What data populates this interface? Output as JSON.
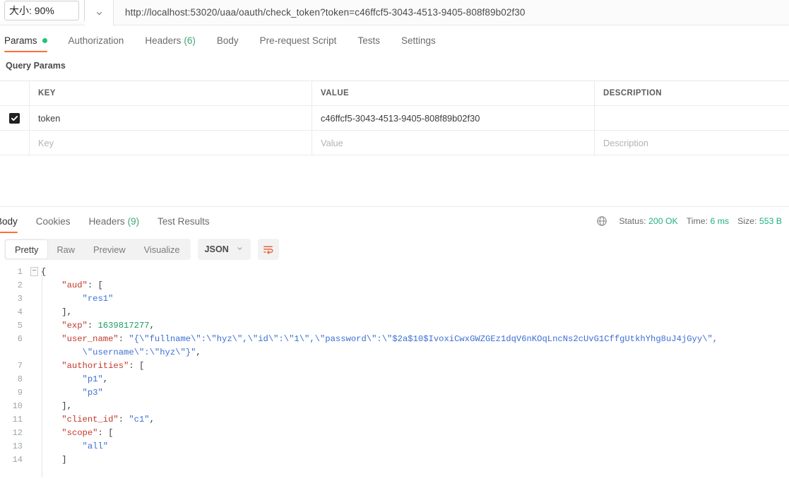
{
  "urlbar": {
    "zoom_label": "大小: 90%",
    "caret_icon": "chevron-down-icon",
    "url": "http://localhost:53020/uaa/oauth/check_token?token=c46ffcf5-3043-4513-9405-808f89b02f30"
  },
  "request_tabs": [
    {
      "label": "Params",
      "active": true,
      "dot": true
    },
    {
      "label": "Authorization",
      "active": false
    },
    {
      "label": "Headers",
      "count": "(6)",
      "active": false
    },
    {
      "label": "Body",
      "active": false
    },
    {
      "label": "Pre-request Script",
      "active": false
    },
    {
      "label": "Tests",
      "active": false
    },
    {
      "label": "Settings",
      "active": false
    }
  ],
  "query_params": {
    "section_label": "Query Params",
    "columns": [
      "KEY",
      "VALUE",
      "DESCRIPTION"
    ],
    "rows": [
      {
        "checked": true,
        "key": "token",
        "value": "c46ffcf5-3043-4513-9405-808f89b02f30",
        "description": ""
      }
    ],
    "placeholder_row": {
      "key": "Key",
      "value": "Value",
      "description": "Description"
    }
  },
  "response_tabs": [
    {
      "label": "Body",
      "active": true
    },
    {
      "label": "Cookies",
      "active": false
    },
    {
      "label": "Headers",
      "count": "(9)",
      "active": false
    },
    {
      "label": "Test Results",
      "active": false
    }
  ],
  "response_meta": {
    "globe_icon": "globe-icon",
    "status_label": "Status:",
    "status_value": "200 OK",
    "time_label": "Time:",
    "time_value": "6 ms",
    "size_label": "Size:",
    "size_value": "553 B"
  },
  "body_toolbar": {
    "formats": [
      "Pretty",
      "Raw",
      "Preview",
      "Visualize"
    ],
    "selected_format": "Pretty",
    "language": "JSON",
    "language_caret": "chevron-down-icon",
    "wrap_icon": "word-wrap-icon"
  },
  "code": {
    "lines": [
      {
        "num": "1",
        "tokens": [
          {
            "t": "p",
            "v": "{"
          }
        ],
        "fold": true
      },
      {
        "num": "2",
        "tokens": [
          {
            "t": "p",
            "v": "    "
          },
          {
            "t": "k",
            "v": "\"aud\""
          },
          {
            "t": "p",
            "v": ": ["
          }
        ]
      },
      {
        "num": "3",
        "tokens": [
          {
            "t": "p",
            "v": "        "
          },
          {
            "t": "s",
            "v": "\"res1\""
          }
        ],
        "guide": true
      },
      {
        "num": "4",
        "tokens": [
          {
            "t": "p",
            "v": "    ],"
          }
        ]
      },
      {
        "num": "5",
        "tokens": [
          {
            "t": "p",
            "v": "    "
          },
          {
            "t": "k",
            "v": "\"exp\""
          },
          {
            "t": "p",
            "v": ": "
          },
          {
            "t": "n",
            "v": "1639817277"
          },
          {
            "t": "p",
            "v": ","
          }
        ]
      },
      {
        "num": "6",
        "tokens": [
          {
            "t": "p",
            "v": "    "
          },
          {
            "t": "k",
            "v": "\"user_name\""
          },
          {
            "t": "p",
            "v": ": "
          },
          {
            "t": "s",
            "v": "\"{\\\"fullname\\\":\\\"hyz\\\",\\\"id\\\":\\\"1\\\",\\\"password\\\":\\\"$2a$10$IvoxiCwxGWZGEz1dqV6nKOqLncNs2cUvG1CffgUtkhYhg8uJ4jGyy\\\","
          }
        ]
      },
      {
        "num": "",
        "tokens": [
          {
            "t": "p",
            "v": "        "
          },
          {
            "t": "s",
            "v": "\\\"username\\\":\\\"hyz\\\"}\""
          },
          {
            "t": "p",
            "v": ","
          }
        ],
        "wrapped": true
      },
      {
        "num": "7",
        "tokens": [
          {
            "t": "p",
            "v": "    "
          },
          {
            "t": "k",
            "v": "\"authorities\""
          },
          {
            "t": "p",
            "v": ": ["
          }
        ]
      },
      {
        "num": "8",
        "tokens": [
          {
            "t": "p",
            "v": "        "
          },
          {
            "t": "s",
            "v": "\"p1\""
          },
          {
            "t": "p",
            "v": ","
          }
        ],
        "guide": true
      },
      {
        "num": "9",
        "tokens": [
          {
            "t": "p",
            "v": "        "
          },
          {
            "t": "s",
            "v": "\"p3\""
          }
        ],
        "guide": true
      },
      {
        "num": "10",
        "tokens": [
          {
            "t": "p",
            "v": "    ],"
          }
        ]
      },
      {
        "num": "11",
        "tokens": [
          {
            "t": "p",
            "v": "    "
          },
          {
            "t": "k",
            "v": "\"client_id\""
          },
          {
            "t": "p",
            "v": ": "
          },
          {
            "t": "s",
            "v": "\"c1\""
          },
          {
            "t": "p",
            "v": ","
          }
        ]
      },
      {
        "num": "12",
        "tokens": [
          {
            "t": "p",
            "v": "    "
          },
          {
            "t": "k",
            "v": "\"scope\""
          },
          {
            "t": "p",
            "v": ": ["
          }
        ]
      },
      {
        "num": "13",
        "tokens": [
          {
            "t": "p",
            "v": "        "
          },
          {
            "t": "s",
            "v": "\"all\""
          }
        ],
        "guide": true
      },
      {
        "num": "14",
        "tokens": [
          {
            "t": "p",
            "v": "    ]"
          }
        ]
      }
    ]
  },
  "colors": {
    "accent_orange": "#ff6c37",
    "success_green": "#22b07d",
    "dot_green": "#21c17b",
    "key_red": "#c0392b",
    "string_blue": "#3b6fd4",
    "number_green": "#1d9c63"
  }
}
